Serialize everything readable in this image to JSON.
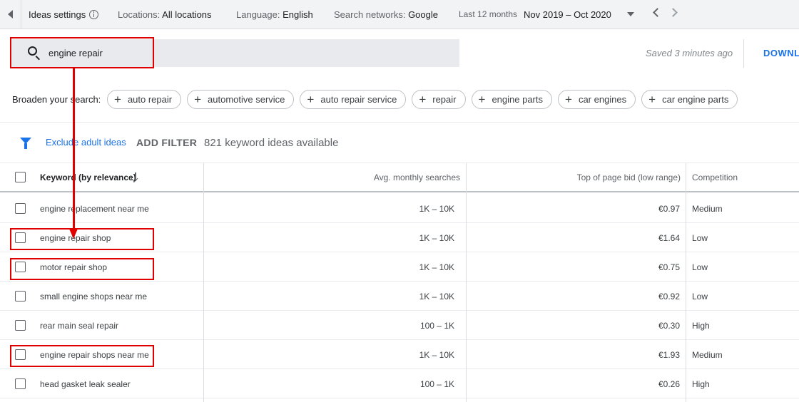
{
  "topbar": {
    "ideas_settings": "Ideas settings",
    "locations_label": "Locations:",
    "locations_value": "All locations",
    "language_label": "Language:",
    "language_value": "English",
    "networks_label": "Search networks:",
    "networks_value": "Google",
    "period_label": "Last 12 months",
    "date_range": "Nov 2019 – Oct 2020"
  },
  "search": {
    "query": "engine repair",
    "saved_status": "Saved 3 minutes ago",
    "download_label": "DOWNL"
  },
  "broaden": {
    "label": "Broaden your search:",
    "chips": [
      "auto repair",
      "automotive service",
      "auto repair service",
      "repair",
      "engine parts",
      "car engines",
      "car engine parts"
    ]
  },
  "filters": {
    "exclude_adult": "Exclude adult ideas",
    "add_filter": "ADD FILTER",
    "count_text": "821 keyword ideas available"
  },
  "table": {
    "headers": {
      "keyword": "Keyword (by relevance)",
      "avg_searches": "Avg. monthly searches",
      "top_bid_low": "Top of page bid (low range)",
      "competition": "Competition"
    },
    "rows": [
      {
        "keyword": "engine replacement near me",
        "avg": "1K – 10K",
        "bid": "€0.97",
        "competition": "Medium"
      },
      {
        "keyword": "engine repair shop",
        "avg": "1K – 10K",
        "bid": "€1.64",
        "competition": "Low"
      },
      {
        "keyword": "motor repair shop",
        "avg": "1K – 10K",
        "bid": "€0.75",
        "competition": "Low"
      },
      {
        "keyword": "small engine shops near me",
        "avg": "1K – 10K",
        "bid": "€0.92",
        "competition": "Low"
      },
      {
        "keyword": "rear main seal repair",
        "avg": "100 – 1K",
        "bid": "€0.30",
        "competition": "High"
      },
      {
        "keyword": "engine repair shops near me",
        "avg": "1K – 10K",
        "bid": "€1.93",
        "competition": "Medium"
      },
      {
        "keyword": "head gasket leak sealer",
        "avg": "100 – 1K",
        "bid": "€0.26",
        "competition": "High"
      }
    ]
  },
  "colors": {
    "accent": "#1a73e8",
    "annotation": "#e00000",
    "topbar_bg": "#f1f3f4",
    "search_bg": "#e8eaed"
  }
}
